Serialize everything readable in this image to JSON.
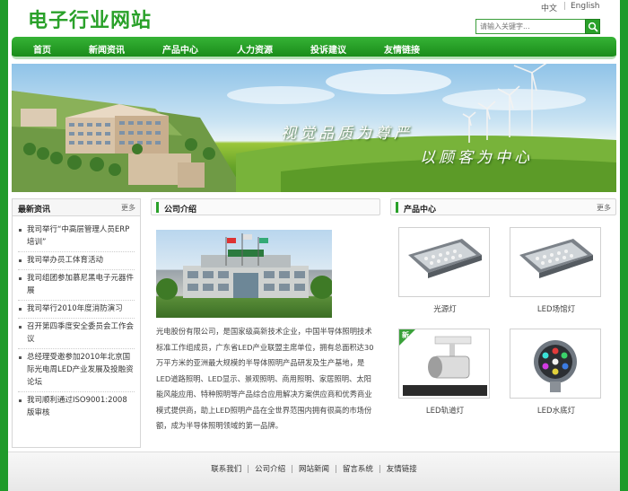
{
  "header": {
    "site_title": "电子行业网站",
    "lang_cn": "中文",
    "lang_en": "English",
    "search_placeholder": "请输入关键字..."
  },
  "nav": {
    "items": [
      "首页",
      "新闻资讯",
      "产品中心",
      "人力资源",
      "投诉建议",
      "友情链接"
    ]
  },
  "banner": {
    "slogan_line1": "视觉品质为尊严",
    "slogan_line2": "以顾客为中心"
  },
  "news": {
    "title": "最新资讯",
    "more": "更多",
    "items": [
      "我司举行“中高层管理人员ERP培训”",
      "我司举办员工体育活动",
      "我司组团参加慕尼黑电子元器件展",
      "我司举行2010年度消防演习",
      "召开第四季度安全委员会工作会议",
      "总经理受邀参加2010年北京国际光电周LED产业发展及投融资论坛",
      "我司顺利通过ISO9001:2008版审核"
    ]
  },
  "company": {
    "title": "公司介绍",
    "text": "光电股份有限公司，是国家级高新技术企业，中国半导体照明技术标准工作组成员，广东省LED产业联盟主席单位，拥有总面积达30万平方米的亚洲最大规模的半导体照明产品研发及生产基地，是LED道路照明、LED显示、景观照明、商用照明、家居照明、太阳能风能应用、特种照明等产品综合应用解决方案供应商和优秀商业模式提供商，助上LED照明产品在全世界范围内拥有很高的市场份额，成为半导体照明领域的第一品牌。"
  },
  "products": {
    "title": "产品中心",
    "more": "更多",
    "items": [
      {
        "name": "光源灯"
      },
      {
        "name": "LED场馆灯"
      },
      {
        "name": "LED轨道灯"
      },
      {
        "name": "LED水底灯"
      }
    ],
    "new_badge": "新"
  },
  "footer": {
    "links": [
      "联系我们",
      "公司介绍",
      "网站新闻",
      "留言系统",
      "友情链接"
    ]
  },
  "colors": {
    "brand_green": "#2aa12a",
    "frame_green": "#1f9a2a"
  }
}
